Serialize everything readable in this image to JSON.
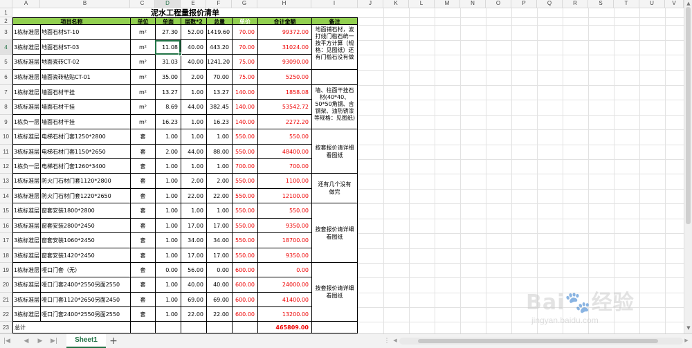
{
  "column_letters": [
    "A",
    "B",
    "C",
    "D",
    "E",
    "F",
    "G",
    "H",
    "I",
    "J",
    "K",
    "L",
    "M",
    "N",
    "O",
    "P",
    "Q",
    "R",
    "S",
    "T",
    "U",
    "V"
  ],
  "row_numbers": [
    "1",
    "2",
    "3",
    "4",
    "5",
    "6",
    "7",
    "8",
    "9",
    "10",
    "11",
    "12",
    "13",
    "14",
    "15",
    "16",
    "17",
    "18",
    "19",
    "20",
    "21",
    "22",
    "23"
  ],
  "title": "泥水工程量报价清单",
  "headers": {
    "name": "项目名称",
    "unit": "单位",
    "single": "单面",
    "floors": "层数*2",
    "total_qty": "总量",
    "price": "单价",
    "amount": "合计金额",
    "remark": "备注"
  },
  "rows": [
    {
      "a": "1栋标准层",
      "b": "地面石材ST-10",
      "unit": "m²",
      "d": "27.30",
      "e": "52.00",
      "f": "1419.60",
      "price": "70.00",
      "amount": "99372.00"
    },
    {
      "a": "3栋标准层",
      "b": "地面石材ST-03",
      "unit": "m²",
      "d": "11.08",
      "e": "40.00",
      "f": "443.20",
      "price": "70.00",
      "amount": "31024.00"
    },
    {
      "a": "3栋标准层",
      "b": "地面瓷砖CT-02",
      "unit": "m²",
      "d": "31.03",
      "e": "40.00",
      "f": "1241.20",
      "price": "75.00",
      "amount": "93090.00"
    },
    {
      "a": "3栋标准层",
      "b": "墙面瓷砖粘贴CT-01",
      "unit": "m²",
      "d": "35.00",
      "e": "2.00",
      "f": "70.00",
      "price": "75.00",
      "amount": "5250.00"
    },
    {
      "a": "1栋标准层",
      "b": "墙面石材干挂",
      "unit": "m²",
      "d": "13.27",
      "e": "1.00",
      "f": "13.27",
      "price": "140.00",
      "amount": "1858.08"
    },
    {
      "a": "3栋标准层",
      "b": "墙面石材干挂",
      "unit": "m²",
      "d": "8.69",
      "e": "44.00",
      "f": "382.45",
      "price": "140.00",
      "amount": "53542.72"
    },
    {
      "a": "1栋负一层",
      "b": "墙面石材干挂",
      "unit": "m²",
      "d": "16.23",
      "e": "1.00",
      "f": "16.23",
      "price": "140.00",
      "amount": "2272.20"
    },
    {
      "a": "1栋标准层",
      "b": "电梯石材门套1250*2800",
      "unit": "套",
      "d": "1.00",
      "e": "1.00",
      "f": "1.00",
      "price": "550.00",
      "amount": "550.00"
    },
    {
      "a": "3栋标准层",
      "b": "电梯石材门套1150*2650",
      "unit": "套",
      "d": "2.00",
      "e": "44.00",
      "f": "88.00",
      "price": "550.00",
      "amount": "48400.00"
    },
    {
      "a": "1栋负一层",
      "b": "电梯石材门套1260*3400",
      "unit": "套",
      "d": "1.00",
      "e": "1.00",
      "f": "1.00",
      "price": "700.00",
      "amount": "700.00"
    },
    {
      "a": "1栋标准层",
      "b": "防火门石材门套1120*2800",
      "unit": "套",
      "d": "1.00",
      "e": "2.00",
      "f": "2.00",
      "price": "550.00",
      "amount": "1100.00"
    },
    {
      "a": "3栋标准层",
      "b": "防火门石材门套1220*2650",
      "unit": "套",
      "d": "1.00",
      "e": "22.00",
      "f": "22.00",
      "price": "550.00",
      "amount": "12100.00"
    },
    {
      "a": "1栋标准层",
      "b": "窗套安装1800*2800",
      "unit": "套",
      "d": "1.00",
      "e": "1.00",
      "f": "1.00",
      "price": "550.00",
      "amount": "550.00"
    },
    {
      "a": "3栋标准层",
      "b": "窗套安装2800*2450",
      "unit": "套",
      "d": "1.00",
      "e": "17.00",
      "f": "17.00",
      "price": "550.00",
      "amount": "9350.00"
    },
    {
      "a": "3栋标准层",
      "b": "窗套安装1060*2450",
      "unit": "套",
      "d": "1.00",
      "e": "34.00",
      "f": "34.00",
      "price": "550.00",
      "amount": "18700.00"
    },
    {
      "a": "3栋标准层",
      "b": "窗套安装1420*2450",
      "unit": "套",
      "d": "1.00",
      "e": "17.00",
      "f": "17.00",
      "price": "550.00",
      "amount": "9350.00"
    },
    {
      "a": "1栋标准层",
      "b": "哑口门套（无）",
      "unit": "套",
      "d": "0.00",
      "e": "56.00",
      "f": "0.00",
      "price": "600.00",
      "amount": "0.00"
    },
    {
      "a": "3栋标准层",
      "b": "哑口门套2400*2550另面2550",
      "unit": "套",
      "d": "1.00",
      "e": "40.00",
      "f": "40.00",
      "price": "600.00",
      "amount": "24000.00"
    },
    {
      "a": "3栋标准层",
      "b": "哑口门套1120*2650另面2450",
      "unit": "套",
      "d": "1.00",
      "e": "69.00",
      "f": "69.00",
      "price": "600.00",
      "amount": "41400.00"
    },
    {
      "a": "3栋标准层",
      "b": "哑口门套2400*2550另面2550",
      "unit": "套",
      "d": "1.00",
      "e": "22.00",
      "f": "22.00",
      "price": "600.00",
      "amount": "13200.00"
    }
  ],
  "total": {
    "label": "总计",
    "amount": "465809.00"
  },
  "remarks": [
    {
      "text": "地面铺石材，波打线门槛石统一按平方计算（规格：见图纸）还有门槛石没有做"
    },
    {
      "text": "墙、柱面干挂石材(40*40、50*50角钢、含钢架、油防锈漆等规格：见图纸)"
    },
    {
      "text": "按套报价请详细看图纸"
    },
    {
      "text": "还有几个没有做完"
    },
    {
      "text": "按套报价请详细看图纸"
    },
    {
      "text": "按套报价请详细看图纸"
    }
  ],
  "sheet_tab": "Sheet1",
  "watermark": {
    "main": "Bai🐾经验",
    "sub": "jingyan.baidu.com"
  },
  "colors": {
    "header_green": "#92d050",
    "red_text": "#ee0000",
    "excel_green": "#217346"
  }
}
